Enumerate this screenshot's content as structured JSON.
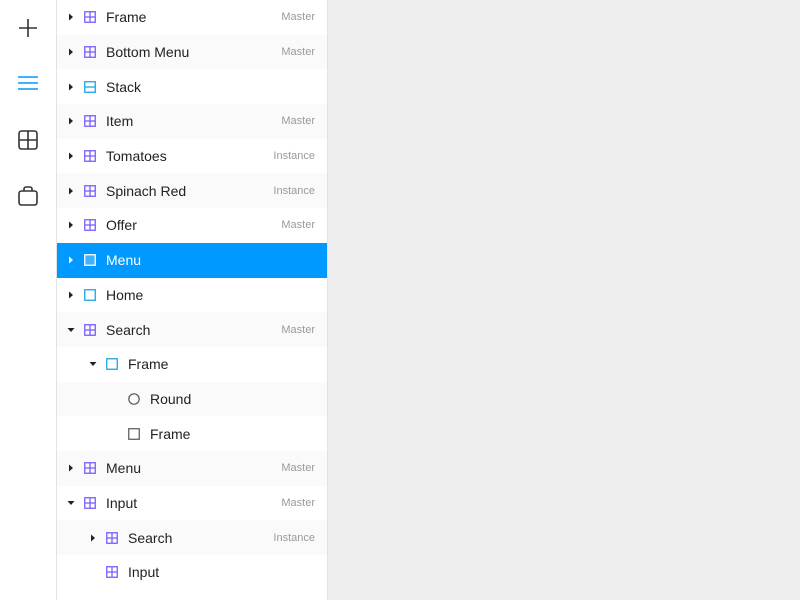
{
  "toolbar": {
    "tools": [
      {
        "icon": "plus-icon",
        "active": false
      },
      {
        "icon": "layers-icon",
        "active": true
      },
      {
        "icon": "components-icon",
        "active": false
      },
      {
        "icon": "store-icon",
        "active": false
      }
    ],
    "accent_color": "#0099ff"
  },
  "layers": {
    "rows": [
      {
        "label": "Frame",
        "tag": "Master",
        "level": 0,
        "caret": "right",
        "icon": "component-icon"
      },
      {
        "label": "Bottom Menu",
        "tag": "Master",
        "level": 0,
        "caret": "right",
        "icon": "component-icon"
      },
      {
        "label": "Stack",
        "tag": "",
        "level": 0,
        "caret": "right",
        "icon": "stack-icon"
      },
      {
        "label": "Item",
        "tag": "Master",
        "level": 0,
        "caret": "right",
        "icon": "component-icon"
      },
      {
        "label": "Tomatoes",
        "tag": "Instance",
        "level": 0,
        "caret": "right",
        "icon": "component-icon"
      },
      {
        "label": "Spinach Red",
        "tag": "Instance",
        "level": 0,
        "caret": "right",
        "icon": "component-icon"
      },
      {
        "label": "Offer",
        "tag": "Master",
        "level": 0,
        "caret": "right",
        "icon": "component-icon"
      },
      {
        "label": "Menu",
        "tag": "",
        "level": 0,
        "caret": "right",
        "icon": "frame-icon",
        "selected": true
      },
      {
        "label": "Home",
        "tag": "",
        "level": 0,
        "caret": "right",
        "icon": "frame-icon"
      },
      {
        "label": "Search",
        "tag": "Master",
        "level": 0,
        "caret": "down",
        "icon": "component-icon"
      },
      {
        "label": "Frame",
        "tag": "",
        "level": 1,
        "caret": "down",
        "icon": "frame-icon"
      },
      {
        "label": "Round",
        "tag": "",
        "level": 2,
        "caret": "none",
        "icon": "oval-icon"
      },
      {
        "label": "Frame",
        "tag": "",
        "level": 2,
        "caret": "none",
        "icon": "rectangle-icon"
      },
      {
        "label": "Menu",
        "tag": "Master",
        "level": 0,
        "caret": "right",
        "icon": "component-icon"
      },
      {
        "label": "Input",
        "tag": "Master",
        "level": 0,
        "caret": "down",
        "icon": "component-icon"
      },
      {
        "label": "Search",
        "tag": "Instance",
        "level": 1,
        "caret": "right",
        "icon": "component-icon"
      },
      {
        "label": "Input",
        "tag": "",
        "level": 1,
        "caret": "none",
        "icon": "component-icon"
      }
    ]
  }
}
